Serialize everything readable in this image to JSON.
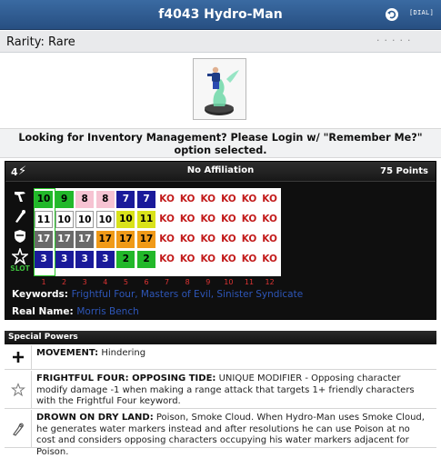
{
  "window": {
    "title": "f4043 Hydro-Man",
    "dial_button": "[DIAL]"
  },
  "rarity": {
    "text": "Rarity: Rare"
  },
  "notice": {
    "text": "Looking for Inventory Management? Please Login w/ \"Remember Me?\" option selected."
  },
  "dial": {
    "range": "4",
    "affiliation": "No Affiliation",
    "points": "75 Points",
    "stat_icons": [
      "speed-icon",
      "attack-icon",
      "defense-icon",
      "damage-icon"
    ],
    "slot_label": "SLOT",
    "slot_numbers": [
      "1",
      "2",
      "3",
      "4",
      "5",
      "6",
      "7",
      "8",
      "9",
      "10",
      "11",
      "12"
    ],
    "rows": [
      [
        {
          "v": "10",
          "bg": "#22b82a",
          "fg": "#000"
        },
        {
          "v": "9",
          "bg": "#22b82a",
          "fg": "#000"
        },
        {
          "v": "8",
          "bg": "#f6c3d2",
          "fg": "#000"
        },
        {
          "v": "8",
          "bg": "#f6c3d2",
          "fg": "#000"
        },
        {
          "v": "7",
          "bg": "#1a1a9a",
          "fg": "#fff"
        },
        {
          "v": "7",
          "bg": "#1a1a9a",
          "fg": "#fff"
        },
        {
          "v": "KO",
          "bg": "#ffffff",
          "fg": "#c21a1a"
        },
        {
          "v": "KO",
          "bg": "#ffffff",
          "fg": "#c21a1a"
        },
        {
          "v": "KO",
          "bg": "#ffffff",
          "fg": "#c21a1a"
        },
        {
          "v": "KO",
          "bg": "#ffffff",
          "fg": "#c21a1a"
        },
        {
          "v": "KO",
          "bg": "#ffffff",
          "fg": "#c21a1a"
        },
        {
          "v": "KO",
          "bg": "#ffffff",
          "fg": "#c21a1a"
        }
      ],
      [
        {
          "v": "11",
          "bg": "#ffffff",
          "fg": "#000"
        },
        {
          "v": "10",
          "bg": "#ffffff",
          "fg": "#000"
        },
        {
          "v": "10",
          "bg": "#ffffff",
          "fg": "#000"
        },
        {
          "v": "10",
          "bg": "#ffffff",
          "fg": "#000"
        },
        {
          "v": "10",
          "bg": "#d9e21a",
          "fg": "#000"
        },
        {
          "v": "11",
          "bg": "#d9e21a",
          "fg": "#000"
        },
        {
          "v": "KO",
          "bg": "#ffffff",
          "fg": "#c21a1a"
        },
        {
          "v": "KO",
          "bg": "#ffffff",
          "fg": "#c21a1a"
        },
        {
          "v": "KO",
          "bg": "#ffffff",
          "fg": "#c21a1a"
        },
        {
          "v": "KO",
          "bg": "#ffffff",
          "fg": "#c21a1a"
        },
        {
          "v": "KO",
          "bg": "#ffffff",
          "fg": "#c21a1a"
        },
        {
          "v": "KO",
          "bg": "#ffffff",
          "fg": "#c21a1a"
        }
      ],
      [
        {
          "v": "17",
          "bg": "#6a6a6a",
          "fg": "#fff"
        },
        {
          "v": "17",
          "bg": "#6a6a6a",
          "fg": "#fff"
        },
        {
          "v": "17",
          "bg": "#6a6a6a",
          "fg": "#fff"
        },
        {
          "v": "17",
          "bg": "#f09a18",
          "fg": "#000"
        },
        {
          "v": "17",
          "bg": "#f09a18",
          "fg": "#000"
        },
        {
          "v": "17",
          "bg": "#f09a18",
          "fg": "#000"
        },
        {
          "v": "KO",
          "bg": "#ffffff",
          "fg": "#c21a1a"
        },
        {
          "v": "KO",
          "bg": "#ffffff",
          "fg": "#c21a1a"
        },
        {
          "v": "KO",
          "bg": "#ffffff",
          "fg": "#c21a1a"
        },
        {
          "v": "KO",
          "bg": "#ffffff",
          "fg": "#c21a1a"
        },
        {
          "v": "KO",
          "bg": "#ffffff",
          "fg": "#c21a1a"
        },
        {
          "v": "KO",
          "bg": "#ffffff",
          "fg": "#c21a1a"
        }
      ],
      [
        {
          "v": "3",
          "bg": "#1a1a9a",
          "fg": "#fff"
        },
        {
          "v": "3",
          "bg": "#1a1a9a",
          "fg": "#fff"
        },
        {
          "v": "3",
          "bg": "#1a1a9a",
          "fg": "#fff"
        },
        {
          "v": "3",
          "bg": "#1a1a9a",
          "fg": "#fff"
        },
        {
          "v": "2",
          "bg": "#22b82a",
          "fg": "#000"
        },
        {
          "v": "2",
          "bg": "#22b82a",
          "fg": "#000"
        },
        {
          "v": "KO",
          "bg": "#ffffff",
          "fg": "#c21a1a"
        },
        {
          "v": "KO",
          "bg": "#ffffff",
          "fg": "#c21a1a"
        },
        {
          "v": "KO",
          "bg": "#ffffff",
          "fg": "#c21a1a"
        },
        {
          "v": "KO",
          "bg": "#ffffff",
          "fg": "#c21a1a"
        },
        {
          "v": "KO",
          "bg": "#ffffff",
          "fg": "#c21a1a"
        },
        {
          "v": "KO",
          "bg": "#ffffff",
          "fg": "#c21a1a"
        }
      ]
    ],
    "keywords_label": "Keywords:",
    "keywords": "Frightful Four, Masters of Evil, Sinister Syndicate",
    "realname_label": "Real Name:",
    "realname": "Morris Bench"
  },
  "special_powers": {
    "header": "Special Powers",
    "items": [
      {
        "icon": "plus-icon",
        "name": "MOVEMENT:",
        "text": " Hindering"
      },
      {
        "icon": "star-icon",
        "name": "FRIGHTFUL FOUR: OPPOSING TIDE:",
        "text": " UNIQUE MODIFIER - Opposing character modify damage -1 when making a range attack that targets 1+ friendly characters with the Frightful Four keyword."
      },
      {
        "icon": "fist-icon",
        "name": "DROWN ON DRY LAND:",
        "text": " Poison, Smoke Cloud. When Hydro-Man uses Smoke Cloud, he generates water markers instead and after resolutions he can use Poison at no cost and considers opposing characters occupying his water markers adjacent for Poison."
      }
    ]
  }
}
